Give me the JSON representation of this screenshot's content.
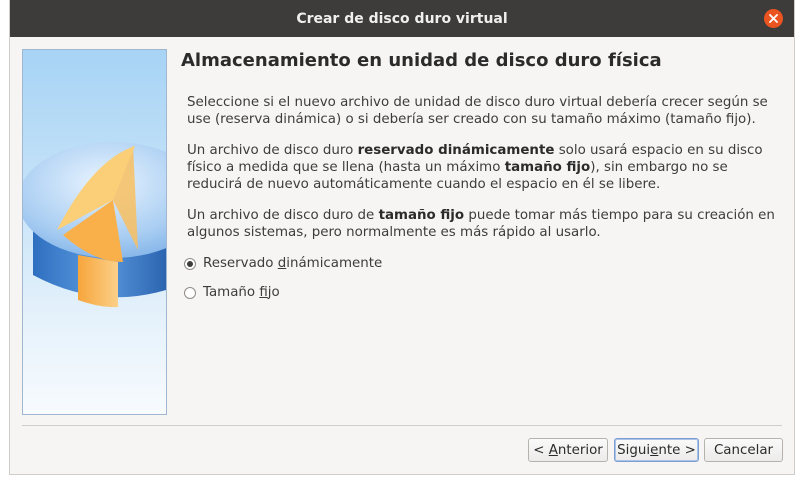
{
  "window": {
    "title": "Crear de disco duro virtual"
  },
  "page": {
    "heading": "Almacenamiento en unidad de disco duro física",
    "para1": "Seleccione si el nuevo archivo de unidad de disco duro virtual debería crecer según se use (reserva dinámica) o si debería ser creado con su tamaño máximo (tamaño fijo).",
    "para2": {
      "t1": "Un archivo de disco duro ",
      "b1": "reservado dinámicamente",
      "t2": " solo usará espacio en su disco físico a medida que se llena (hasta un máximo ",
      "b2": "tamaño fijo",
      "t3": "), sin embargo no se reducirá de nuevo automáticamente cuando el espacio en él se libere."
    },
    "para3": {
      "t1": "Un archivo de disco duro de ",
      "b1": "tamaño fijo",
      "t2": " puede tomar más tiempo para su creación en algunos sistemas, pero normalmente es más rápido al usarlo."
    }
  },
  "options": {
    "selected": "dynamic",
    "dynamic": {
      "pre": "Reservado ",
      "mnemonic": "d",
      "post": "inámicamente"
    },
    "fixed": {
      "pre": "Tamaño ",
      "mnemonic": "f",
      "post": "ijo"
    }
  },
  "buttons": {
    "back": {
      "pre": "< ",
      "mnemonic": "A",
      "post": "nterior"
    },
    "next": {
      "pre": "Sigui",
      "mnemonic": "e",
      "post": "nte >"
    },
    "cancel": "Cancelar"
  },
  "colors": {
    "titlebar": "#3d3c3a",
    "close": "#e95420",
    "accent": "#7c9fcf"
  }
}
